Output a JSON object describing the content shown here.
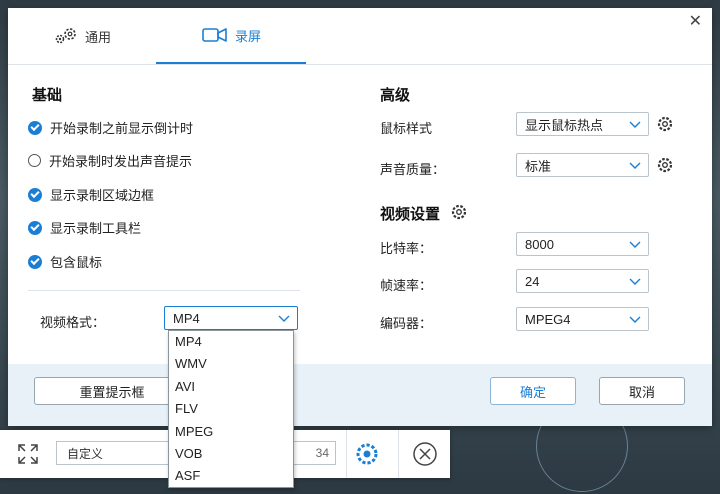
{
  "tabs": [
    {
      "label": "通用",
      "icon": "gears-icon"
    },
    {
      "label": "录屏",
      "icon": "camera-icon",
      "active": true
    }
  ],
  "basic": {
    "title": "基础",
    "options": [
      {
        "label": "开始录制之前显示倒计时",
        "checked": true
      },
      {
        "label": "开始录制时发出声音提示",
        "checked": false
      },
      {
        "label": "显示录制区域边框",
        "checked": true
      },
      {
        "label": "显示录制工具栏",
        "checked": true
      },
      {
        "label": "包含鼠标",
        "checked": true
      }
    ],
    "format_label": "视频格式：",
    "format_value": "MP4",
    "format_options": [
      "MP4",
      "WMV",
      "AVI",
      "FLV",
      "MPEG",
      "VOB",
      "ASF"
    ]
  },
  "advanced": {
    "title": "高级",
    "mouse_style_label": "鼠标样式",
    "mouse_style_value": "显示鼠标热点",
    "audio_quality_label": "声音质量：",
    "audio_quality_value": "标准"
  },
  "video": {
    "title": "视频设置",
    "bitrate_label": "比特率：",
    "bitrate_value": "8000",
    "framerate_label": "帧速率：",
    "framerate_value": "24",
    "encoder_label": "编码器：",
    "encoder_value": "MPEG4"
  },
  "footer": {
    "reset_label": "重置提示框",
    "ok_label": "确定",
    "cancel_label": "取消"
  },
  "bottombar": {
    "preset_value": "自定义",
    "partial_number": "34"
  },
  "colors": {
    "accent": "#1a7fd4"
  }
}
